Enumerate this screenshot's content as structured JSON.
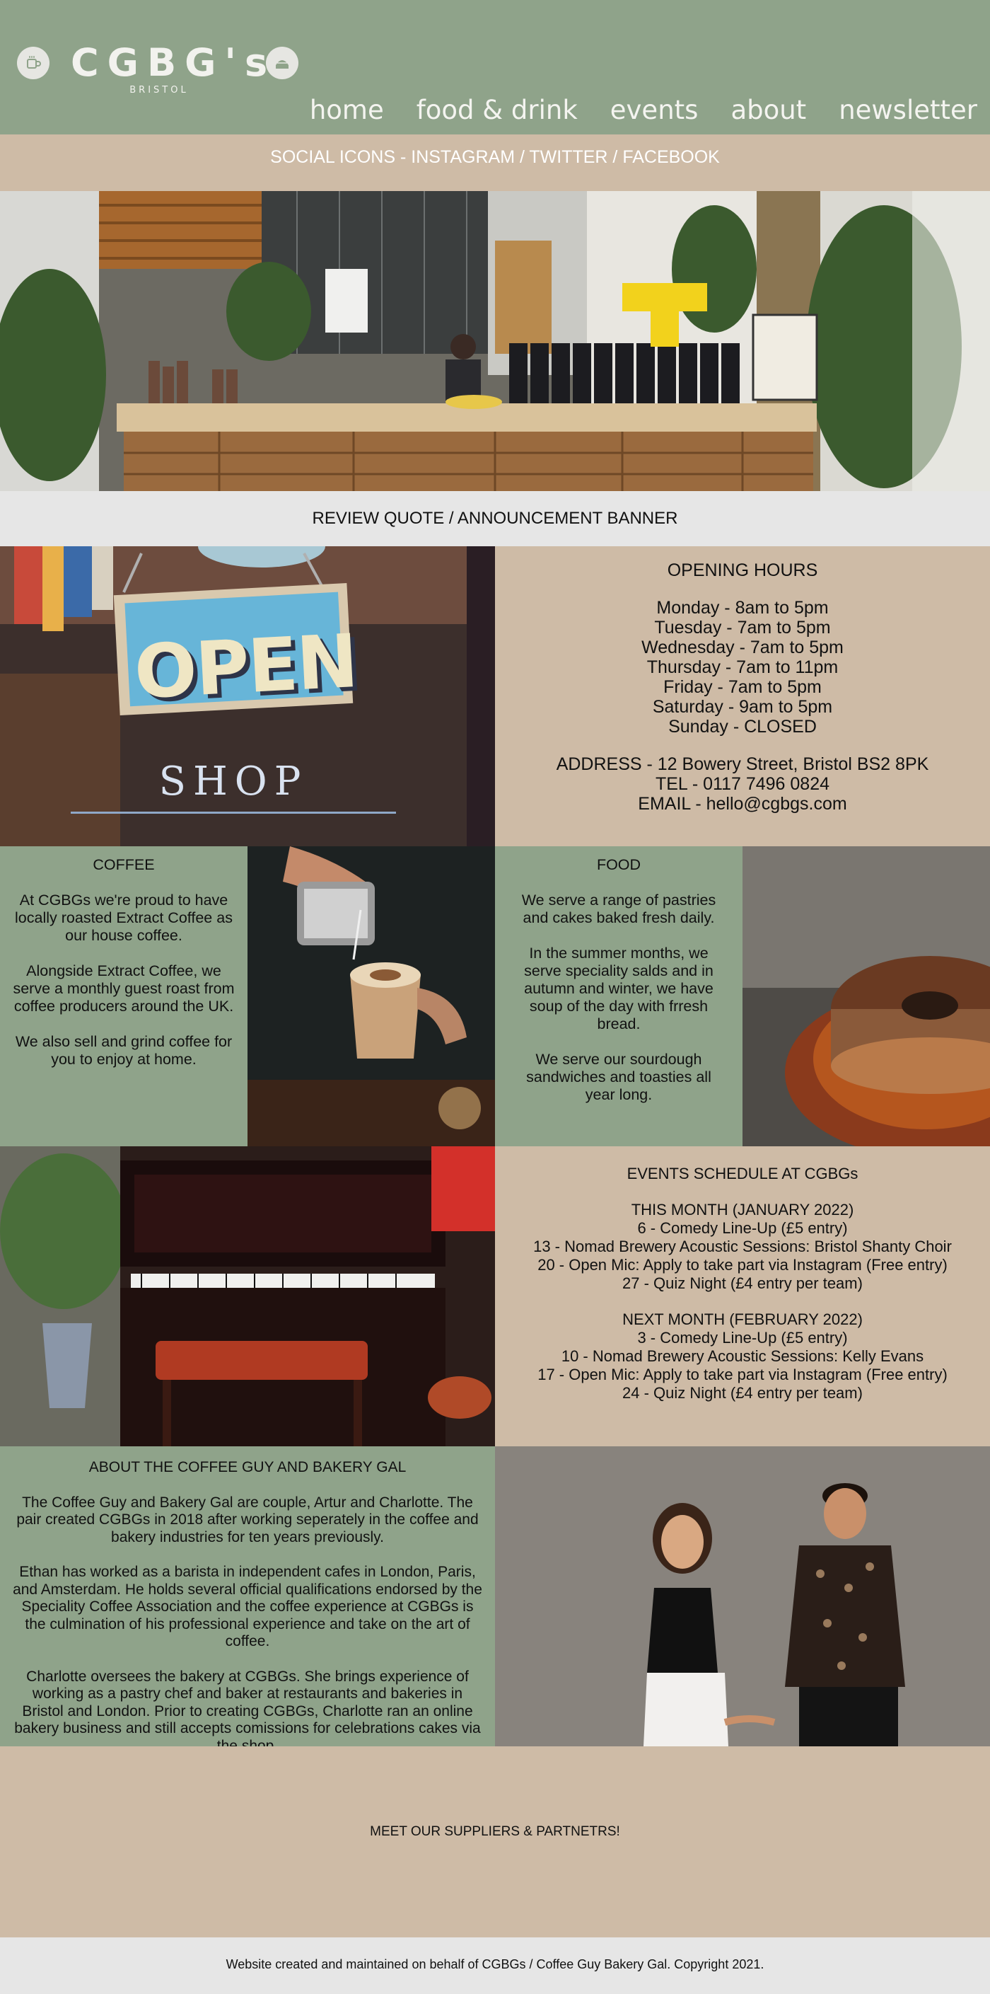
{
  "header": {
    "logo_title": "CGBG's",
    "logo_subtitle": "BRISTOL",
    "nav": [
      "home",
      "food & drink",
      "events",
      "about",
      "newsletter"
    ]
  },
  "social": {
    "text": "SOCIAL ICONS - INSTAGRAM / TWITTER / FACEBOOK"
  },
  "banner": {
    "text": "REVIEW QUOTE / ANNOUNCEMENT BANNER"
  },
  "open_sign": {
    "sign_text": "OPEN",
    "shop_text": "SHOP"
  },
  "hours": {
    "title": "OPENING HOURS",
    "days": [
      "Monday - 8am to 5pm",
      "Tuesday - 7am to 5pm",
      "Wednesday - 7am to 5pm",
      "Thursday - 7am to 11pm",
      "Friday - 7am to 5pm",
      "Saturday - 9am to 5pm",
      "Sunday -  CLOSED"
    ],
    "address": "ADDRESS - 12 Bowery Street, Bristol BS2 8PK",
    "tel": "TEL - 0117 7496 0824",
    "email": "EMAIL - hello@cgbgs.com"
  },
  "coffee": {
    "title": "COFFEE",
    "paragraphs": [
      "At CGBGs we're proud to have locally roasted Extract Coffee as our house coffee.",
      "Alongside Extract Coffee, we serve a monthly guest roast from coffee producers around the UK.",
      "We also sell and grind coffee for you to enjoy at home."
    ]
  },
  "food": {
    "title": "FOOD",
    "paragraphs": [
      "We serve a range of pastries and cakes baked fresh daily.",
      "In the summer months, we serve speciality salds and in autumn and winter, we have soup of the day with frresh bread.",
      "We serve our sourdough sandwiches and toasties all year long."
    ]
  },
  "events": {
    "title": "EVENTS SCHEDULE AT CGBGs",
    "this_month_title": "THIS MONTH (JANUARY 2022)",
    "this_month": [
      "6 - Comedy Line-Up (£5 entry)",
      "13 - Nomad Brewery Acoustic Sessions: Bristol Shanty Choir",
      "20 - Open Mic: Apply to take part via Instagram (Free entry)",
      "27 - Quiz Night (£4 entry per team)"
    ],
    "next_month_title": "NEXT MONTH (FEBRUARY 2022)",
    "next_month": [
      "3 - Comedy Line-Up (£5 entry)",
      "10 - Nomad Brewery Acoustic Sessions: Kelly Evans",
      "17 - Open Mic: Apply to take part via Instagram  (Free entry)",
      "24 - Quiz Night (£4 entry per team)"
    ]
  },
  "about": {
    "title": "ABOUT THE COFFEE GUY AND BAKERY GAL",
    "paragraphs": [
      "The Coffee Guy and Bakery Gal are couple, Artur and Charlotte. The pair created CGBGs in 2018 after working seperately in the coffee and bakery industries for ten years previously.",
      "Ethan has worked as a barista in independent cafes in London, Paris, and Amsterdam. He holds several official qualifications endorsed by the Speciality Coffee Association and the coffee experience at CGBGs is the culmination of his professional experience and take on the art of coffee.",
      "Charlotte oversees the bakery at CGBGs. She brings experience of working as a pastry chef and baker at restaurants and bakeries in Bristol and London.  Prior to creating CGBGs, Charlotte ran an online bakery business and still accepts comissions for celebrations cakes via the shop."
    ]
  },
  "suppliers": {
    "text": "MEET OUR SUPPLIERS & PARTNETRS!"
  },
  "footer": {
    "text": "Website created and maintained on behalf of CGBGs / Coffee Guy Bakery Gal. Copyright 2021."
  },
  "colors": {
    "sage": "#8fa38a",
    "tan": "#cebba6",
    "light_grey": "#e6e6e6"
  }
}
